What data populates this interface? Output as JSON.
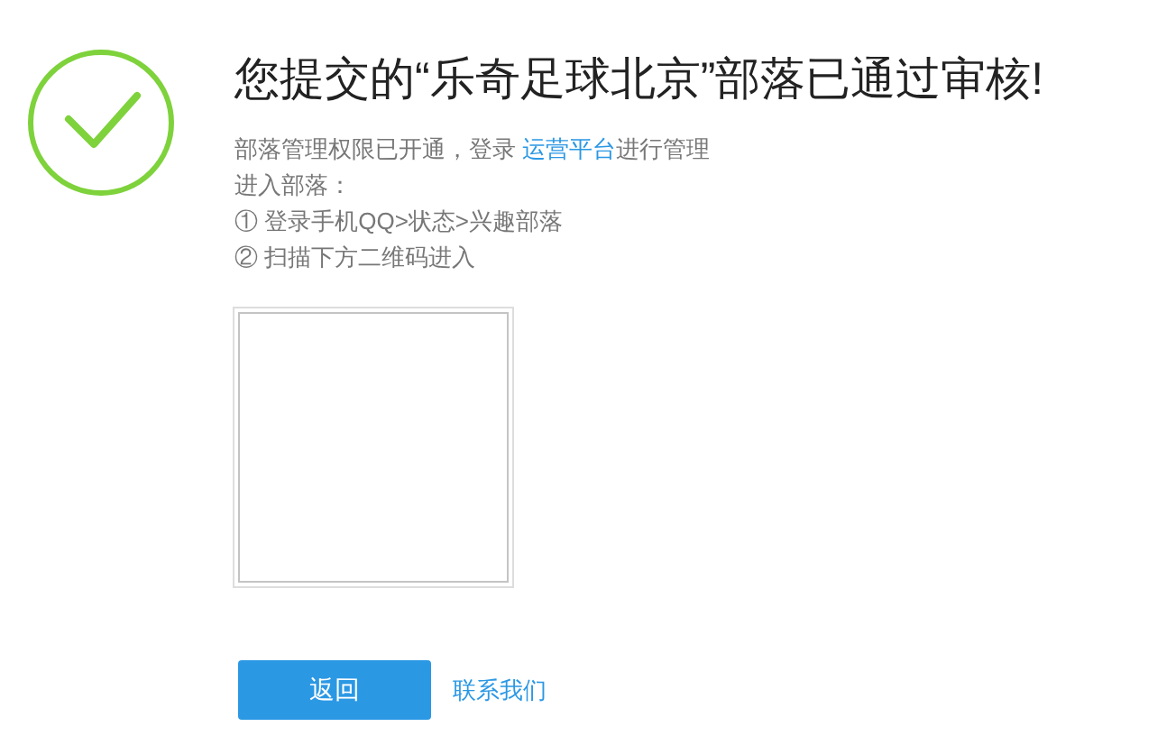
{
  "title": "您提交的“乐奇足球北京”部落已通过审核!",
  "notice": {
    "before": "部落管理权限已开通，登录 ",
    "link": "运营平台",
    "after": "进行管理"
  },
  "steps": [
    "进入部落：",
    "① 登录手机QQ>状态>兴趣部落",
    "② 扫描下方二维码进入"
  ],
  "buttons": {
    "primary": "返回",
    "link": "联系我们"
  }
}
